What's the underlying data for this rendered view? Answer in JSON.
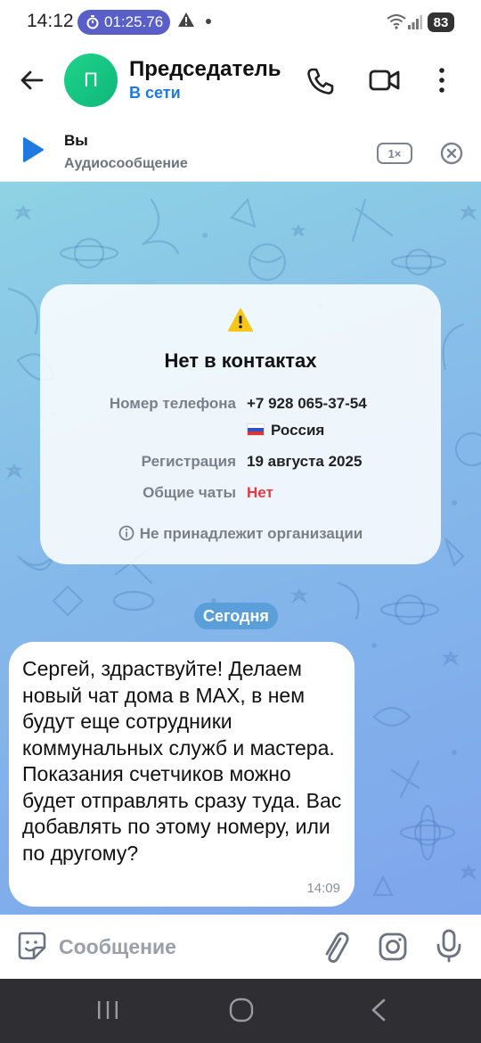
{
  "status_bar": {
    "time": "14:12",
    "timer": "01:25.76",
    "battery": "83"
  },
  "header": {
    "avatar_letter": "П",
    "contact_name": "Председатель",
    "contact_status": "В сети"
  },
  "audio_player": {
    "title": "Вы",
    "subtitle": "Аудиосообщение",
    "speed": "1×"
  },
  "info_card": {
    "title": "Нет в контактах",
    "phone_label": "Номер телефона",
    "phone_value": "+7 928 065-37-54",
    "country": "Россия",
    "registration_label": "Регистрация",
    "registration_value": "19 августа 2025",
    "common_chats_label": "Общие чаты",
    "common_chats_value": "Нет",
    "footer": "Не принадлежит организации"
  },
  "date_divider": "Сегодня",
  "message": {
    "text": "Сергей, здраствуйте! Делаем новый чат дома в MAX, в нем будут еще сотрудники коммунальных служб и мастера. Показания счетчиков можно будет отправлять сразу туда. Вас добавлять по этому номеру, или по другому?",
    "time": "14:09"
  },
  "composer": {
    "placeholder": "Сообщение"
  },
  "colors": {
    "accent": "#1f7ae0",
    "avatar": "#1fd38a",
    "negative": "#e53945",
    "timer_pill": "#5a5fc8"
  },
  "icons": [
    "back-arrow-icon",
    "phone-icon",
    "video-camera-icon",
    "more-vertical-icon",
    "play-icon",
    "close-circle-icon",
    "warning-icon",
    "info-icon",
    "sticker-icon",
    "paperclip-icon",
    "camera-icon",
    "microphone-icon"
  ]
}
